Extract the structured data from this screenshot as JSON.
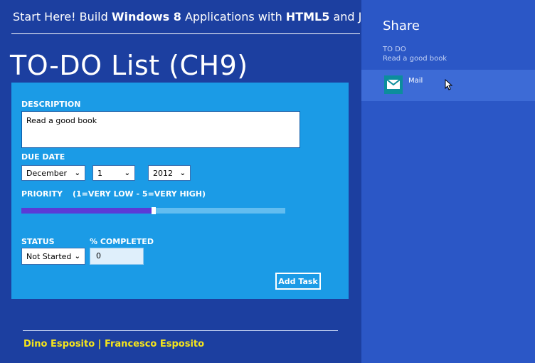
{
  "app": {
    "banner_part1": "Start Here! Build ",
    "banner_bold1": "Windows 8",
    "banner_part2": " Applications with ",
    "banner_bold2": "HTML5",
    "banner_part3": " and J",
    "title": "TO-DO List (CH9)"
  },
  "form": {
    "description_label": "DESCRIPTION",
    "description_value": "Read a good book",
    "due_date_label": "DUE DATE",
    "month": "December",
    "day": "1",
    "year": "2012",
    "priority_label": "PRIORITY",
    "priority_hint": "(1=VERY LOW - 5=VERY HIGH)",
    "priority_fraction": 0.5,
    "status_label": "STATUS",
    "status_value": "Not Started",
    "percent_label": "% COMPLETED",
    "percent_value": "0",
    "add_button": "Add Task"
  },
  "footer": {
    "authors": "Dino Esposito | Francesco Esposito"
  },
  "share_charm": {
    "title": "Share",
    "app_name": "TO DO",
    "item": "Read a good book",
    "target_mail": "Mail"
  },
  "colors": {
    "app_bg": "#1c3fa0",
    "panel_bg": "#1b9be6",
    "charm_bg": "#2b57c6",
    "footer_text": "#f5e51b",
    "slider_fill": "#5b3ad6"
  }
}
